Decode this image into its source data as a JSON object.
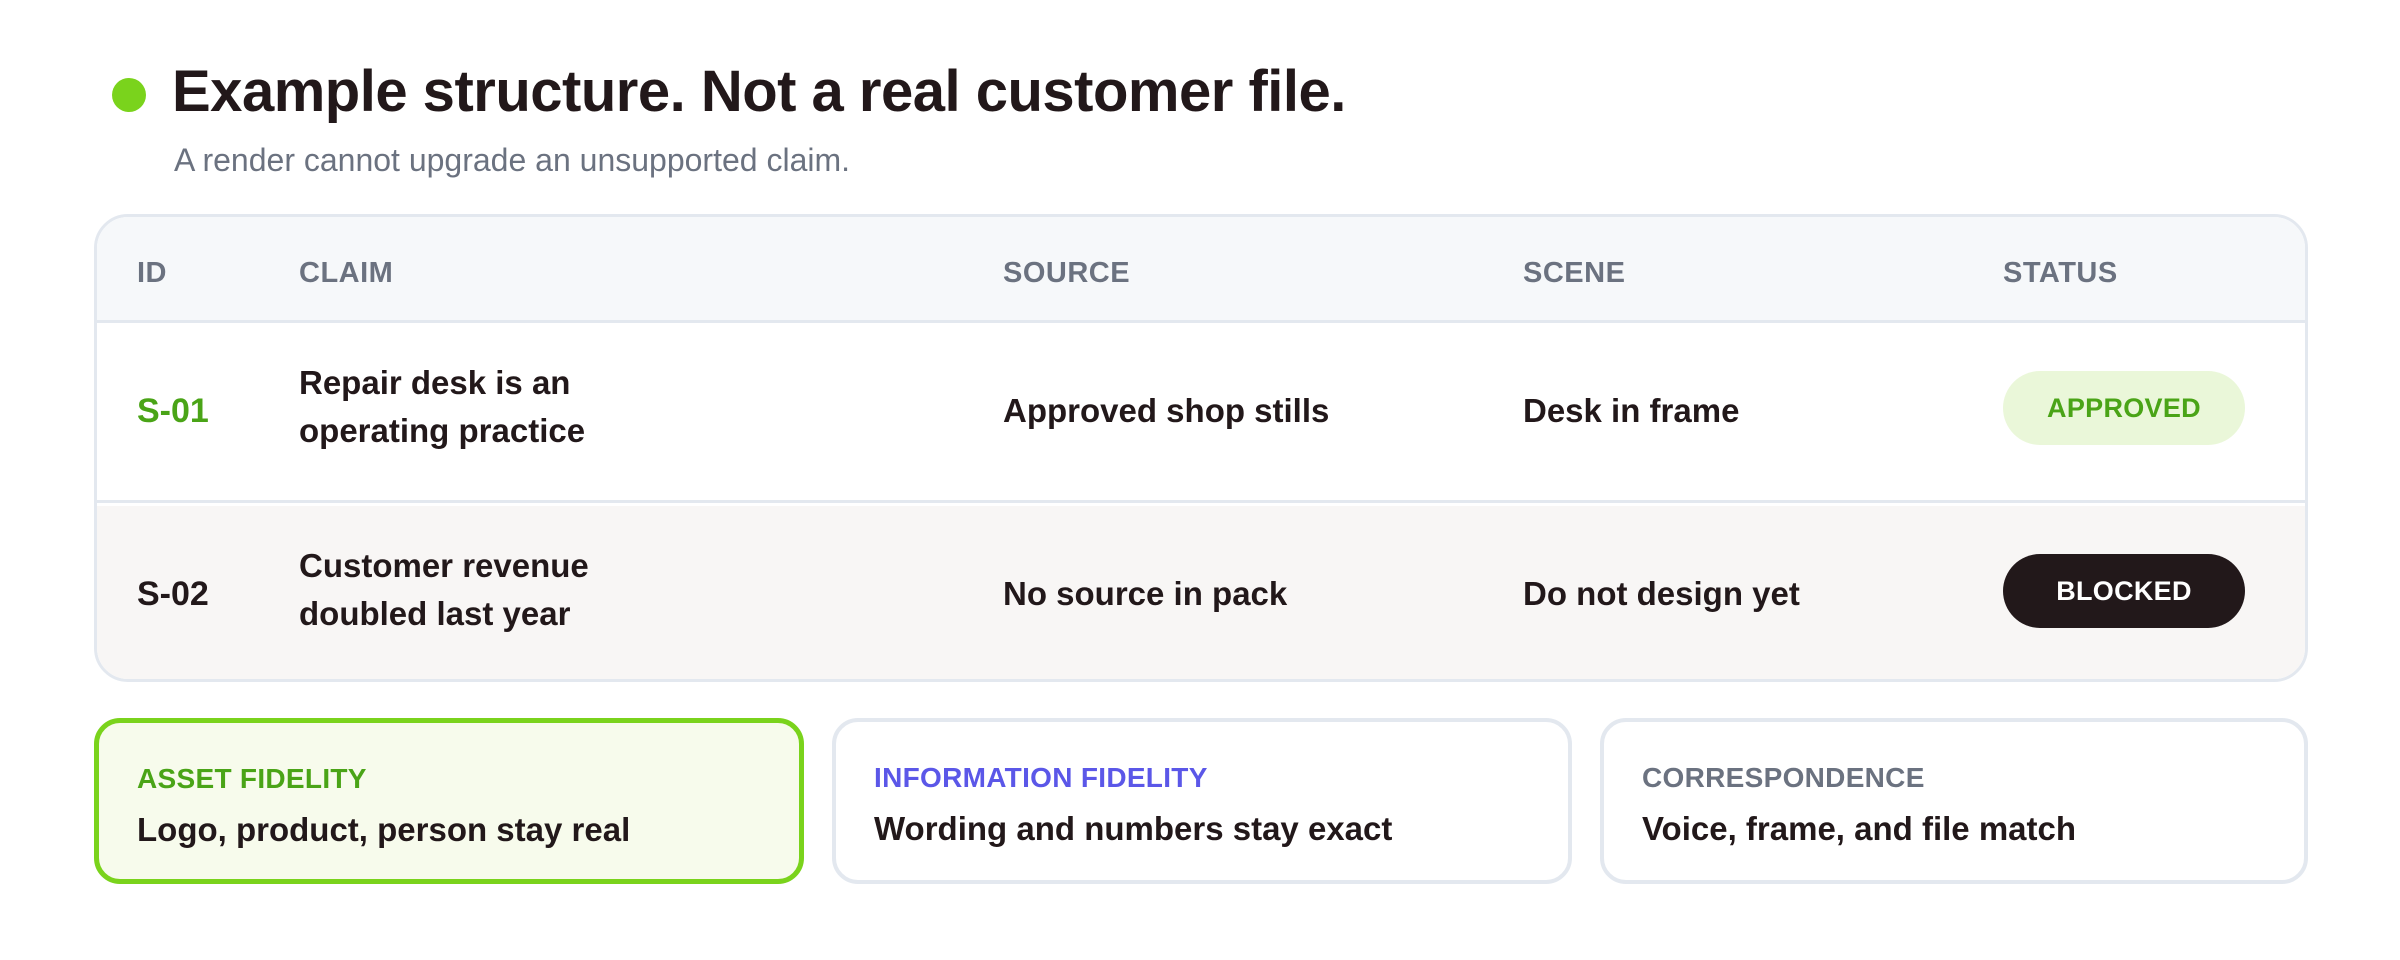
{
  "header": {
    "title": "Example structure. Not a real customer file.",
    "subtitle": "A render cannot upgrade an unsupported claim.",
    "dot_color": "#7ad31c"
  },
  "table": {
    "columns": [
      "ID",
      "CLAIM",
      "SOURCE",
      "SCENE",
      "STATUS"
    ],
    "rows": [
      {
        "id": "S-01",
        "claim_line1": "Repair desk is an",
        "claim_line2": "operating practice",
        "source": "Approved shop stills",
        "scene": "Desk in frame",
        "status": "APPROVED"
      },
      {
        "id": "S-02",
        "claim_line1": "Customer revenue",
        "claim_line2": "doubled last year",
        "source": "No source in pack",
        "scene": "Do not design yet",
        "status": "BLOCKED"
      }
    ]
  },
  "cards": [
    {
      "label": "ASSET FIDELITY",
      "text": "Logo, product, person stay real",
      "accent": "#4aa417"
    },
    {
      "label": "INFORMATION FIDELITY",
      "text": "Wording and numbers stay exact",
      "accent": "#5b57e8"
    },
    {
      "label": "CORRESPONDENCE",
      "text": "Voice, frame, and file match",
      "accent": "#6b7280"
    }
  ]
}
